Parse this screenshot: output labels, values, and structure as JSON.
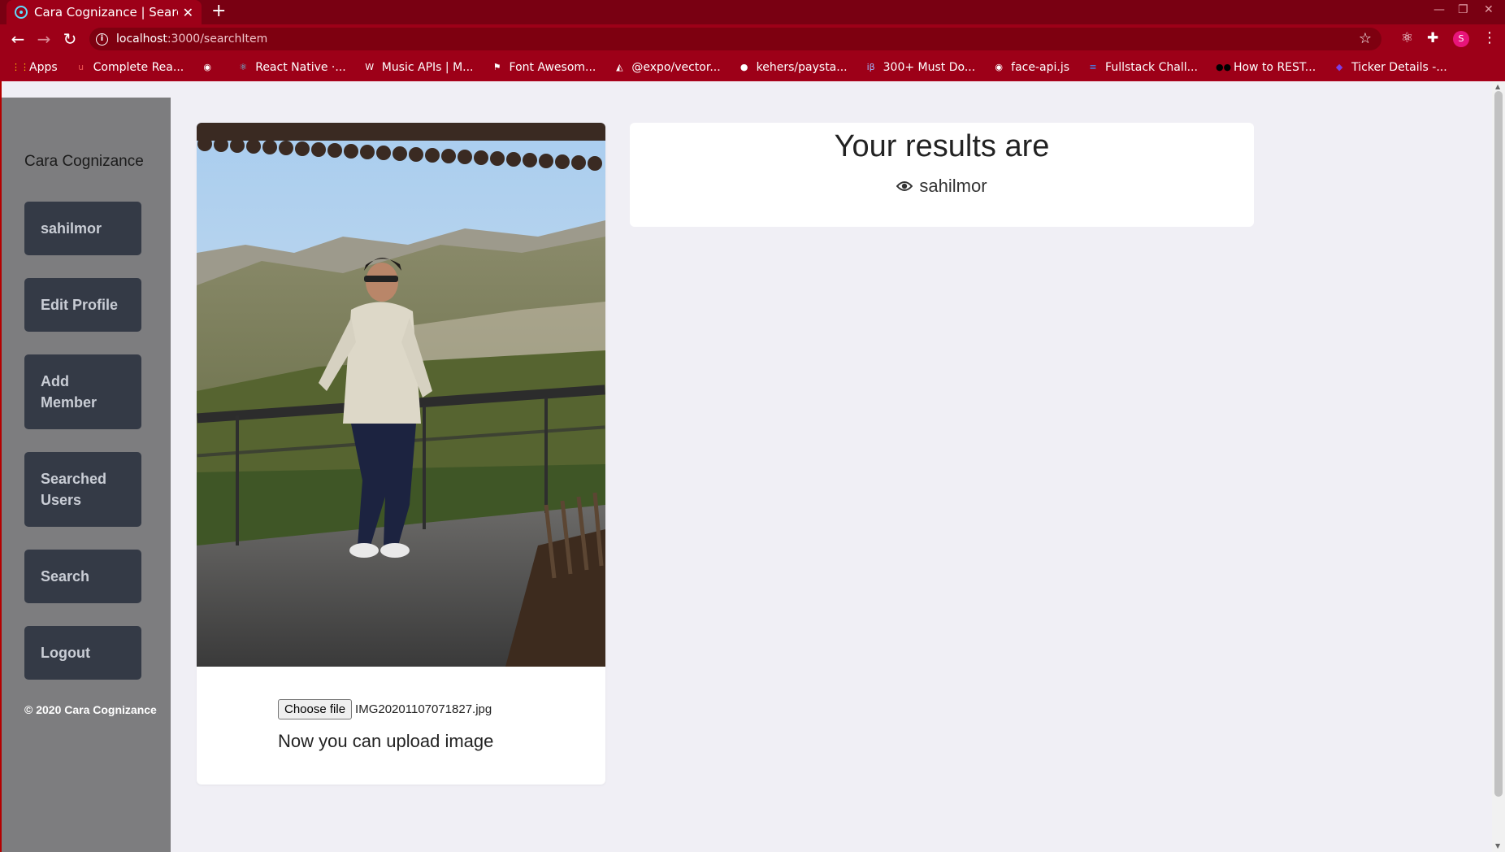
{
  "browser": {
    "tab_title": "Cara Cognizance | Search",
    "tab_close": "✕",
    "new_tab": "+",
    "url_host": "localhost",
    "url_path": ":3000/searchItem",
    "profile_initial": "S",
    "bookmarks": [
      {
        "label": "Apps",
        "icon": "apps-grid-icon",
        "color": "#ffcc00"
      },
      {
        "label": "Complete Rea...",
        "icon": "udemy-icon",
        "color": "#ec5252"
      },
      {
        "label": "",
        "icon": "globe-icon",
        "color": "#ffffff"
      },
      {
        "label": "React Native ·...",
        "icon": "react-icon",
        "color": "#61dafb"
      },
      {
        "label": "Music APIs | M...",
        "icon": "wordpress-icon",
        "color": "#ffffff"
      },
      {
        "label": "Font Awesom...",
        "icon": "flag-icon",
        "color": "#ffffff"
      },
      {
        "label": "@expo/vector...",
        "icon": "expo-icon",
        "color": "#ffffff"
      },
      {
        "label": "kehers/paysta...",
        "icon": "github-icon",
        "color": "#ffffff"
      },
      {
        "label": "300+ Must Do...",
        "icon": "ib-icon",
        "color": "#9fb8ff"
      },
      {
        "label": "face-api.js",
        "icon": "globe-icon",
        "color": "#ffffff"
      },
      {
        "label": "Fullstack Chall...",
        "icon": "docs-icon",
        "color": "#4285f4"
      },
      {
        "label": "How to REST...",
        "icon": "medium-icon",
        "color": "#000000"
      },
      {
        "label": "Ticker Details -...",
        "icon": "polygon-icon",
        "color": "#7b3fe4"
      }
    ]
  },
  "sidebar": {
    "brand": "Cara Cognizance",
    "items": [
      {
        "label": "sahilmor"
      },
      {
        "label": "Edit Profile"
      },
      {
        "label": "Add Member"
      },
      {
        "label": "Searched Users"
      },
      {
        "label": "Search"
      },
      {
        "label": "Logout"
      }
    ],
    "copyright": "© 2020 Cara Cognizance"
  },
  "upload": {
    "choose_label": "Choose file",
    "file_name": "IMG20201107071827.jpg",
    "message": "Now you can upload image"
  },
  "results": {
    "title": "Your results are",
    "items": [
      "sahilmor"
    ]
  },
  "colors": {
    "browser_frame": "#9d0018",
    "sidebar_bg": "#7d7d7f",
    "side_button_bg": "#343a46",
    "page_bg": "#f0eff5"
  }
}
